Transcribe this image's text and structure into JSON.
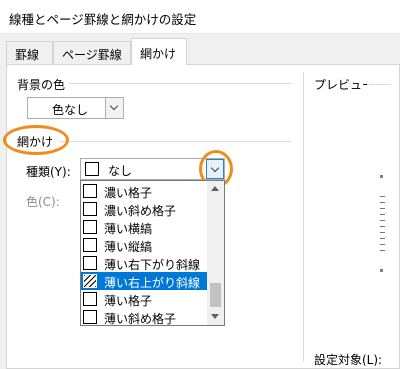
{
  "window": {
    "title": "線種とページ罫線と網かけの設定"
  },
  "tabs": [
    {
      "label": "罫線"
    },
    {
      "label": "ページ罫線"
    },
    {
      "label": "網かけ",
      "active": true
    }
  ],
  "background": {
    "label": "背景の色",
    "select_value": "色なし"
  },
  "shading": {
    "label": "網かけ",
    "type_label": "種類(Y):",
    "type_value": "なし",
    "color_label": "色(C):"
  },
  "preview": {
    "label": "プレビュー",
    "apply_label": "設定対象(L):"
  },
  "dropdown": {
    "items": [
      {
        "label": "濃い格子",
        "icon": "pattern-dense-grid-icon"
      },
      {
        "label": "濃い斜め格子",
        "icon": "pattern-dense-diagonal-grid-icon"
      },
      {
        "label": "薄い横縞",
        "icon": "pattern-light-horizontal-icon"
      },
      {
        "label": "薄い縦縞",
        "icon": "pattern-light-vertical-icon"
      },
      {
        "label": "薄い右下がり斜線",
        "icon": "pattern-light-down-diagonal-icon"
      },
      {
        "label": "薄い右上がり斜線",
        "icon": "pattern-light-up-diagonal-icon",
        "selected": true
      },
      {
        "label": "薄い格子",
        "icon": "pattern-light-grid-icon"
      },
      {
        "label": "薄い斜め格子",
        "icon": "pattern-light-diagonal-grid-icon"
      }
    ],
    "selected_color": "#0078d7"
  },
  "colors": {
    "highlight_ring": "#f28a1c"
  }
}
